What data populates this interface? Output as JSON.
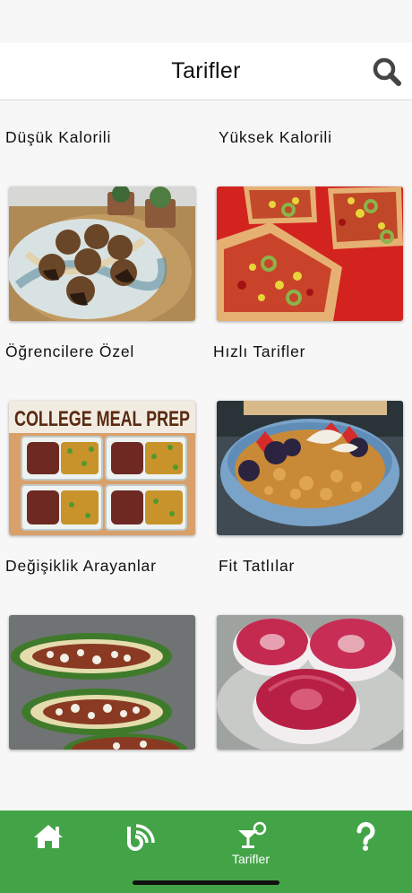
{
  "header": {
    "title": "Tarifler",
    "search_icon": "search-icon"
  },
  "categories": [
    {
      "label": "Düşük Kalorili",
      "image": "cookies-on-plate-photo"
    },
    {
      "label": "Yüksek Kalorili",
      "image": "pizza-slices-photo"
    },
    {
      "label": "Öğrencilere Özel",
      "image": "college-meal-prep-photo",
      "image_text": "COLLEGE MEAL PREP"
    },
    {
      "label": "Hızlı Tarifler",
      "image": "granola-bowl-photo"
    },
    {
      "label": "Değişiklik Arayanlar",
      "image": "stuffed-zucchini-photo"
    },
    {
      "label": "Fit Tatlılar",
      "image": "donut-desserts-photo"
    }
  ],
  "bottom_nav": {
    "items": [
      {
        "icon": "home-icon",
        "label": ""
      },
      {
        "icon": "blog-icon",
        "label": ""
      },
      {
        "icon": "cocktail-icon",
        "label": "Tarifler",
        "active": true
      },
      {
        "icon": "help-icon",
        "label": ""
      }
    ]
  },
  "colors": {
    "nav_background": "#43a447",
    "app_bar": "#ffffff",
    "page_background": "#f7f7f7"
  }
}
